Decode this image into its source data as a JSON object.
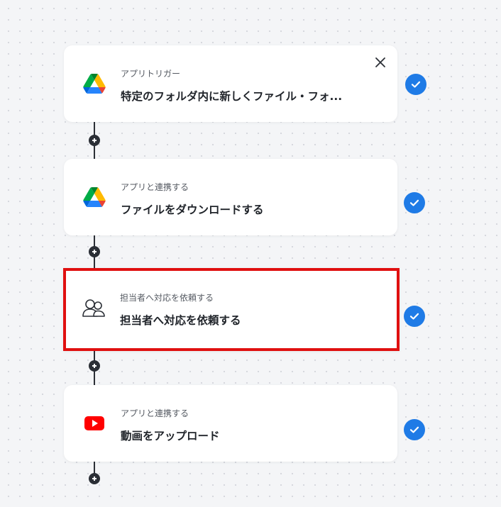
{
  "steps": [
    {
      "subtitle": "アプリトリガー",
      "title": "特定のフォルダ内に新しくファイル・フォ...",
      "icon": "google-drive-icon",
      "close_icon": "close-icon",
      "status": "completed"
    },
    {
      "subtitle": "アプリと連携する",
      "title": "ファイルをダウンロードする",
      "icon": "google-drive-icon",
      "status": "completed"
    },
    {
      "subtitle": "担当者へ対応を依頼する",
      "title": "担当者へ対応を依頼する",
      "icon": "people-icon",
      "status": "completed",
      "highlighted": true
    },
    {
      "subtitle": "アプリと連携する",
      "title": "動画をアップロード",
      "icon": "youtube-icon",
      "status": "completed"
    }
  ],
  "colors": {
    "canvas": "#f4f5f7",
    "check": "#1f7be6",
    "highlight_border": "#e01010",
    "connector": "#2b2f36",
    "youtube_red": "#ff0000"
  }
}
